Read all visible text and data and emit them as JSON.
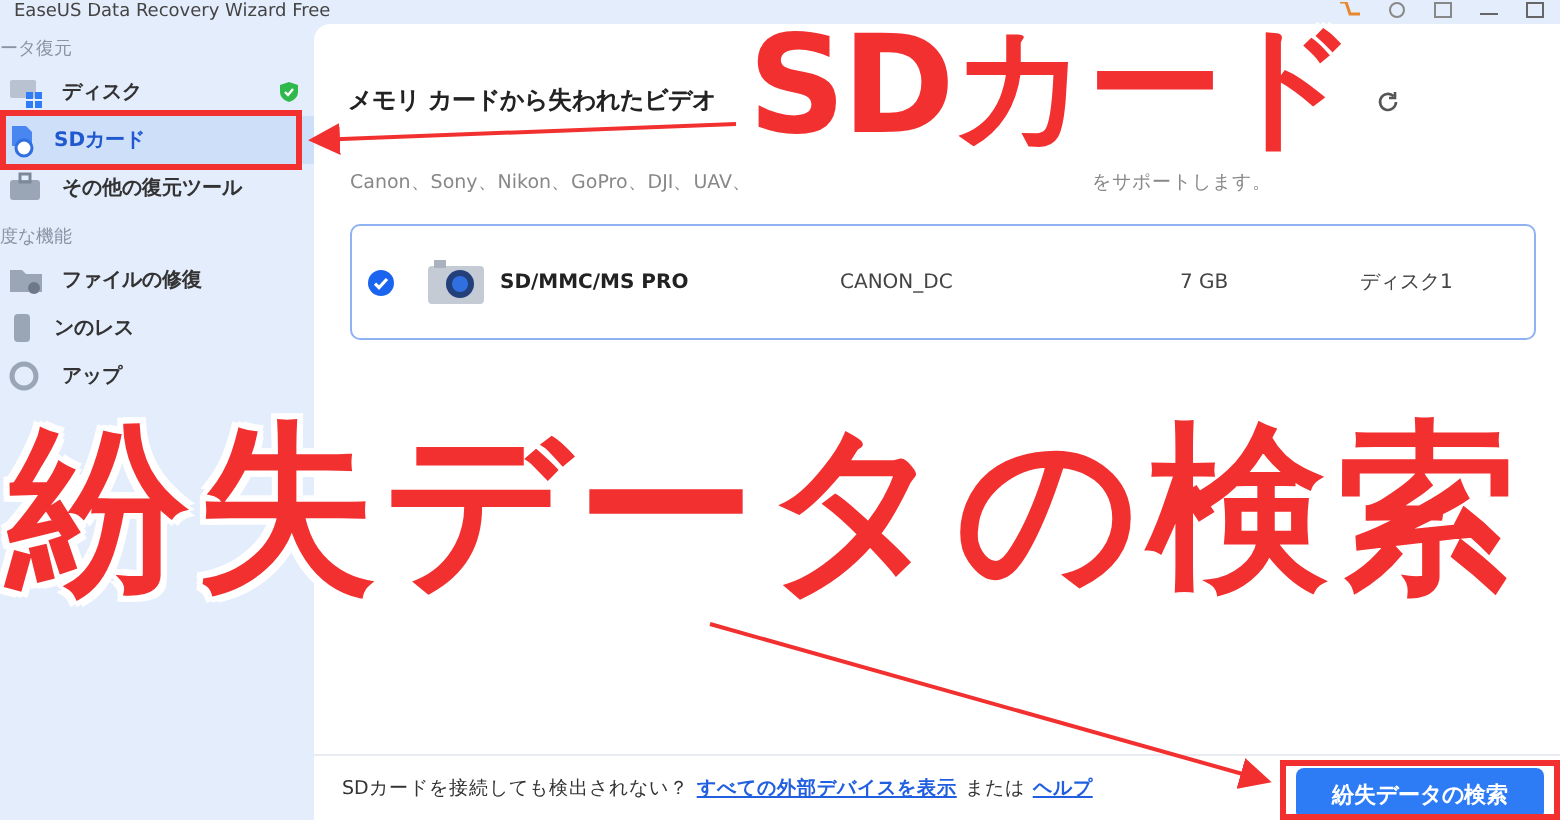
{
  "app_title": "EaseUS Data Recovery Wizard Free",
  "sidebar": {
    "sections": [
      {
        "label": "ータ復元",
        "items": [
          {
            "label": "ディスク",
            "selected": false,
            "shield": true,
            "kind": "disk"
          },
          {
            "label": "SDカード",
            "selected": true,
            "shield": false,
            "kind": "sd"
          },
          {
            "label": "その他の復元ツール",
            "selected": false,
            "shield": false,
            "kind": "tools"
          }
        ]
      },
      {
        "label": "度な機能",
        "items": [
          {
            "label": "ファイルの修復",
            "selected": false,
            "shield": false,
            "kind": "repair"
          },
          {
            "label": "ンのレス",
            "selected": false,
            "shield": false,
            "kind": "phone"
          },
          {
            "label": "アップ",
            "selected": false,
            "shield": false,
            "kind": "backup"
          }
        ]
      }
    ]
  },
  "main": {
    "title": "メモリ カードから失われたビデオ",
    "subtitle_start": "Canon、Sony、Nikon、GoPro、DJI、UAV、",
    "subtitle_end": "をサポートします。",
    "devices": [
      {
        "name": "SD/MMC/MS PRO",
        "label": "CANON_DC",
        "size": "7 GB",
        "disk": "ディスク1",
        "checked": true
      }
    ],
    "footer": {
      "question": "SDカードを接続しても検出されない？",
      "link_1": "すべての外部デバイスを表示",
      "or": "または",
      "link_2": "ヘルプ",
      "button": "紛失データの検索"
    }
  },
  "annotations": {
    "headline": "SDカード",
    "caption": "紛失データの検索"
  }
}
